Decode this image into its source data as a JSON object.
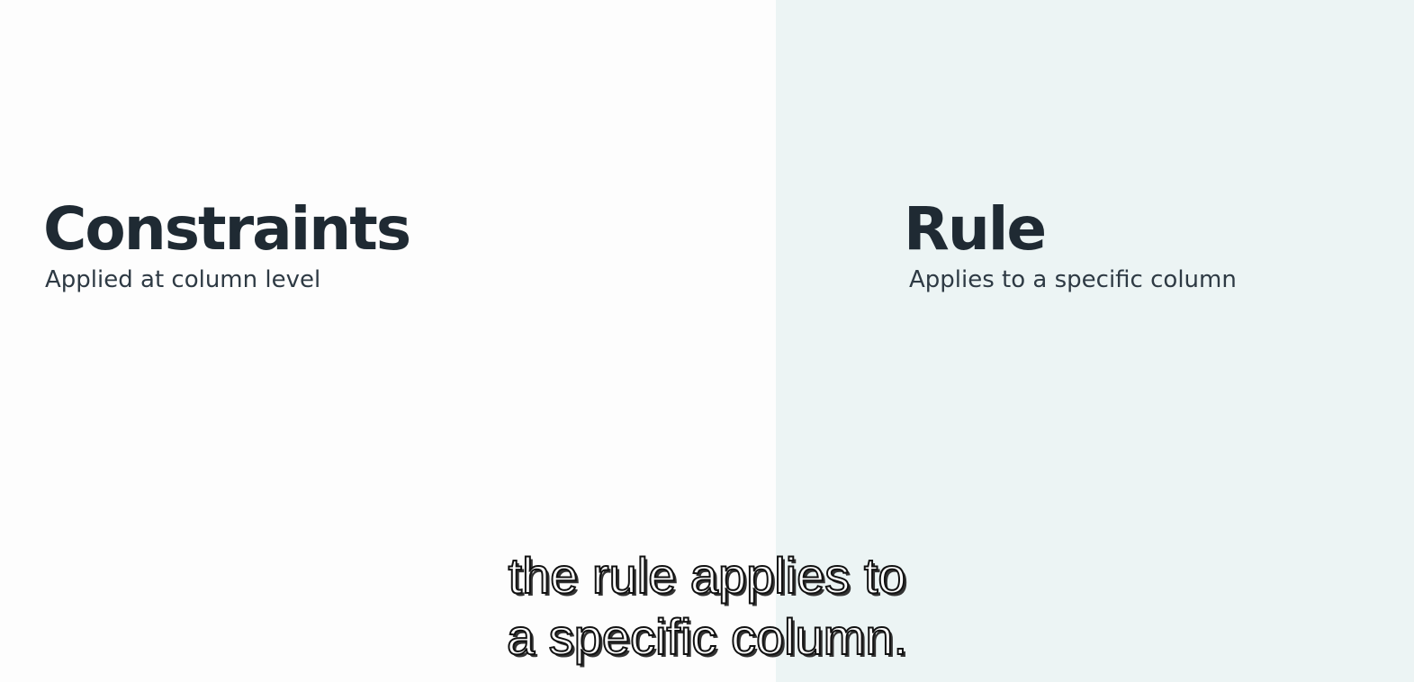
{
  "colors": {
    "left_background": "#fdfdfd",
    "right_background": "#ecf4f4",
    "heading_text": "#1f2a33",
    "subtitle_text": "#2e3a44"
  },
  "left_panel": {
    "title": "Constraints",
    "subtitle": "Applied at column level"
  },
  "right_panel": {
    "title": "Rule",
    "subtitle": "Applies to a specific column"
  },
  "caption": {
    "line1": "the rule applies to",
    "line2": "a specific column."
  }
}
